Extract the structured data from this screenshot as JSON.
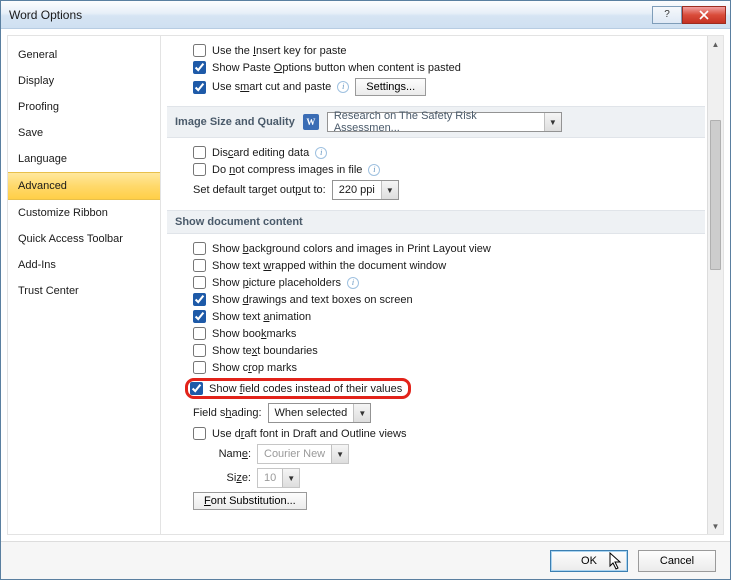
{
  "window": {
    "title": "Word Options"
  },
  "sidebar": {
    "items": [
      {
        "label": "General"
      },
      {
        "label": "Display"
      },
      {
        "label": "Proofing"
      },
      {
        "label": "Save"
      },
      {
        "label": "Language"
      },
      {
        "label": "Advanced",
        "selected": true
      },
      {
        "label": "Customize Ribbon"
      },
      {
        "label": "Quick Access Toolbar"
      },
      {
        "label": "Add-Ins"
      },
      {
        "label": "Trust Center"
      }
    ]
  },
  "top_options": {
    "insert_key": {
      "checked": false,
      "pre": "Use the ",
      "u": "I",
      "post": "nsert key for paste"
    },
    "paste_options": {
      "checked": true,
      "pre": "Show Paste ",
      "u": "O",
      "post": "ptions button when content is pasted"
    },
    "smart_cut": {
      "checked": true,
      "pre": "Use s",
      "u": "m",
      "post": "art cut and paste",
      "settings_btn": "Settings..."
    }
  },
  "section_image": {
    "head": "Image Size and Quality",
    "combo": "Research on The Safety Risk Assessmen...",
    "discard": {
      "checked": false,
      "pre": "Dis",
      "u": "c",
      "post": "ard editing data"
    },
    "nocompress": {
      "checked": false,
      "pre": "Do ",
      "u": "n",
      "post": "ot compress images in file"
    },
    "default_target": {
      "pre": "Set default target out",
      "u": "p",
      "post": "ut to:",
      "combo": "220 ppi"
    }
  },
  "section_doc": {
    "head": "Show document content",
    "bg_colors": {
      "checked": false,
      "pre": "Show ",
      "u": "b",
      "post": "ackground colors and images in Print Layout view"
    },
    "wrap": {
      "checked": false,
      "pre": "Show text ",
      "u": "w",
      "post": "rapped within the document window"
    },
    "placeholders": {
      "checked": false,
      "pre": "Show ",
      "u": "p",
      "post": "icture placeholders"
    },
    "drawings": {
      "checked": true,
      "pre": "Show ",
      "u": "d",
      "post": "rawings and text boxes on screen"
    },
    "animation": {
      "checked": true,
      "pre": "Show text ",
      "u": "a",
      "post": "nimation"
    },
    "bookmarks": {
      "checked": false,
      "pre": "Show boo",
      "u": "k",
      "post": "marks"
    },
    "boundaries": {
      "checked": false,
      "pre": "Show te",
      "u": "x",
      "post": "t boundaries"
    },
    "crop": {
      "checked": false,
      "pre": "Show c",
      "u": "r",
      "post": "op marks"
    },
    "field_codes": {
      "checked": true,
      "pre": "Show ",
      "u": "f",
      "post": "ield codes instead of their values"
    },
    "field_shading": {
      "pre": "Field s",
      "u": "h",
      "post": "ading:",
      "combo": "When selected"
    },
    "draft_font": {
      "checked": false,
      "pre": "Use d",
      "u": "r",
      "post": "aft font in Draft and Outline views"
    },
    "font_name": {
      "label_pre": "Nam",
      "label_u": "e",
      "label_post": ":",
      "combo": "Courier New"
    },
    "font_size": {
      "label_pre": "Si",
      "label_u": "z",
      "label_post": "e:",
      "combo": "10"
    },
    "font_sub_btn_pre": "",
    "font_sub_btn_u": "F",
    "font_sub_btn_post": "ont Substitution..."
  },
  "footer": {
    "ok": "OK",
    "cancel": "Cancel"
  }
}
